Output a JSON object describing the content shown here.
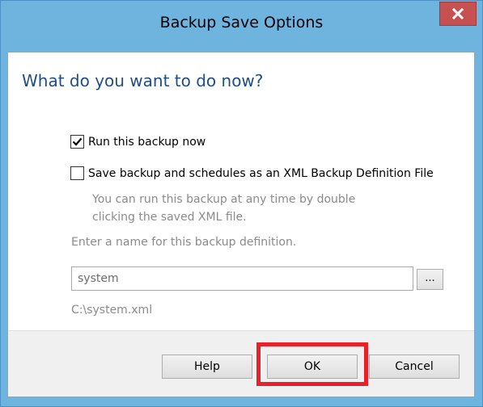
{
  "window": {
    "title": "Backup Save Options",
    "close_icon": "close-icon",
    "close_button_color": "#c75050"
  },
  "content": {
    "heading": "What do you want to do now?",
    "run_now": {
      "label": "Run this backup now",
      "checked": true
    },
    "save_xml": {
      "label": "Save backup and schedules as an XML Backup Definition File",
      "checked": false
    },
    "hint_line1": "You can run this backup at any time by double",
    "hint_line2": "clicking the saved XML file.",
    "name_label": "Enter a name for this backup definition.",
    "name_value": "system",
    "browse_label": "...",
    "path": "C:\\system.xml"
  },
  "footer": {
    "help_label": "Help",
    "ok_label": "OK",
    "cancel_label": "Cancel",
    "highlight_color": "#e8202a"
  }
}
